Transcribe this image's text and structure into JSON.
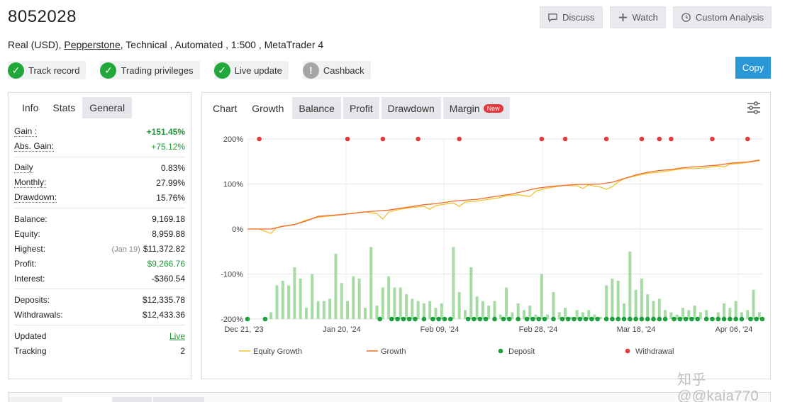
{
  "header": {
    "title": "8052028",
    "account_type": "Real (USD),",
    "broker": "Pepperstone",
    "details": ", Technical , Automated , 1:500 , MetaTrader 4"
  },
  "top_buttons": {
    "discuss": "Discuss",
    "watch": "Watch",
    "custom_analysis": "Custom Analysis"
  },
  "badges": [
    {
      "label": "Track record",
      "icon": "check-icon",
      "status": "ok"
    },
    {
      "label": "Trading privileges",
      "icon": "check-icon",
      "status": "ok"
    },
    {
      "label": "Live update",
      "icon": "check-icon",
      "status": "ok"
    },
    {
      "label": "Cashback",
      "icon": "exclamation-icon",
      "status": "gray"
    }
  ],
  "copy_button": "Copy",
  "left_tabs": [
    "Info",
    "Stats",
    "General"
  ],
  "stats": {
    "gain": {
      "label": "Gain :",
      "value": "+151.45%"
    },
    "abs_gain": {
      "label": "Abs. Gain:",
      "value": "+75.12%"
    },
    "daily": {
      "label": "Daily",
      "value": "0.83%"
    },
    "monthly": {
      "label": "Monthly:",
      "value": "27.99%"
    },
    "drawdown": {
      "label": "Drawdown:",
      "value": "15.76%"
    },
    "balance": {
      "label": "Balance:",
      "value": "9,169.18"
    },
    "equity": {
      "label": "Equity:",
      "value": "8,959.88"
    },
    "highest": {
      "label": "Highest:",
      "note": "(Jan 19)",
      "value": "$11,372.82"
    },
    "profit": {
      "label": "Profit:",
      "value": "$9,266.76"
    },
    "interest": {
      "label": "Interest:",
      "value": "-$360.54"
    },
    "deposits": {
      "label": "Deposits:",
      "value": "$12,335.78"
    },
    "withdrawals": {
      "label": "Withdrawals:",
      "value": "$12,433.36"
    },
    "updated": {
      "label": "Updated",
      "value": "Live"
    },
    "tracking": {
      "label": "Tracking",
      "value": "2"
    }
  },
  "chart_tabs": [
    "Chart",
    "Growth",
    "Balance",
    "Profit",
    "Drawdown",
    "Margin"
  ],
  "new_badge": "New",
  "watermark": "知乎 @@kaia770",
  "chart_data": {
    "type": "line",
    "y_ticks": [
      "200%",
      "100%",
      "0%",
      "-100%",
      "-200%"
    ],
    "ylim": [
      -200,
      200
    ],
    "x_ticks": [
      "Dec 21, '23",
      "Jan 20, '24",
      "Feb 09, '24",
      "Feb 28, '24",
      "Mar 18, '24",
      "Apr 06, '24"
    ],
    "x_range": [
      0,
      112
    ],
    "x_tick_positions": [
      -4,
      16,
      36,
      56,
      76,
      96
    ],
    "grid": true,
    "legend_placement": "bottom",
    "series": [
      {
        "name": "Equity Growth",
        "kind": "line",
        "color": "#f2c230",
        "points": [
          [
            0,
            0
          ],
          [
            4,
            0
          ],
          [
            8,
            -10
          ],
          [
            10,
            4
          ],
          [
            16,
            10
          ],
          [
            20,
            20
          ],
          [
            24,
            26
          ],
          [
            32,
            32
          ],
          [
            40,
            38
          ],
          [
            44,
            34
          ],
          [
            46,
            22
          ],
          [
            48,
            38
          ],
          [
            52,
            44
          ],
          [
            56,
            48
          ],
          [
            60,
            50
          ],
          [
            62,
            44
          ],
          [
            64,
            52
          ],
          [
            70,
            58
          ],
          [
            72,
            50
          ],
          [
            74,
            60
          ],
          [
            78,
            62
          ],
          [
            82,
            66
          ],
          [
            86,
            70
          ],
          [
            88,
            74
          ],
          [
            92,
            76
          ],
          [
            96,
            72
          ],
          [
            98,
            84
          ],
          [
            100,
            88
          ],
          [
            104,
            93
          ],
          [
            108,
            97
          ],
          [
            110,
            96
          ],
          [
            112,
            96
          ],
          [
            114,
            90
          ],
          [
            116,
            98
          ],
          [
            118,
            95
          ],
          [
            120,
            93
          ],
          [
            122,
            88
          ],
          [
            124,
            94
          ],
          [
            126,
            104
          ],
          [
            128,
            112
          ],
          [
            132,
            118
          ],
          [
            136,
            124
          ],
          [
            140,
            126
          ],
          [
            144,
            130
          ],
          [
            148,
            134
          ],
          [
            152,
            134
          ],
          [
            156,
            136
          ],
          [
            160,
            140
          ],
          [
            162,
            138
          ],
          [
            164,
            144
          ],
          [
            168,
            146
          ],
          [
            170,
            148
          ],
          [
            172,
            150
          ],
          [
            174,
            152
          ]
        ]
      },
      {
        "name": "Growth",
        "kind": "line",
        "color": "#f26a2a",
        "points": [
          [
            0,
            0
          ],
          [
            8,
            0
          ],
          [
            12,
            6
          ],
          [
            16,
            10
          ],
          [
            20,
            18
          ],
          [
            24,
            28
          ],
          [
            32,
            32
          ],
          [
            40,
            38
          ],
          [
            44,
            40
          ],
          [
            48,
            42
          ],
          [
            52,
            46
          ],
          [
            56,
            50
          ],
          [
            60,
            54
          ],
          [
            64,
            56
          ],
          [
            70,
            62
          ],
          [
            74,
            64
          ],
          [
            78,
            66
          ],
          [
            82,
            70
          ],
          [
            86,
            74
          ],
          [
            90,
            78
          ],
          [
            94,
            84
          ],
          [
            98,
            90
          ],
          [
            100,
            92
          ],
          [
            104,
            95
          ],
          [
            108,
            97
          ],
          [
            112,
            99
          ],
          [
            116,
            99
          ],
          [
            120,
            100
          ],
          [
            124,
            104
          ],
          [
            128,
            112
          ],
          [
            132,
            120
          ],
          [
            136,
            126
          ],
          [
            140,
            130
          ],
          [
            144,
            132
          ],
          [
            148,
            136
          ],
          [
            152,
            138
          ],
          [
            156,
            140
          ],
          [
            160,
            142
          ],
          [
            164,
            146
          ],
          [
            168,
            148
          ],
          [
            170,
            149
          ],
          [
            172,
            151
          ],
          [
            174,
            153
          ]
        ]
      },
      {
        "name": "Deposit",
        "kind": "dots",
        "color": "#1a9e3a",
        "x": [
          0,
          6,
          45,
          49,
          51,
          53,
          55,
          57,
          60,
          63,
          65,
          67,
          69,
          75,
          77,
          79,
          81,
          84,
          87,
          89,
          92,
          95,
          97,
          99,
          101,
          104,
          107,
          109,
          111,
          113,
          115,
          117,
          119,
          122,
          124,
          126,
          128,
          130,
          132,
          134,
          136,
          138,
          140,
          142,
          145,
          147,
          149,
          151,
          153,
          156,
          158,
          160,
          162,
          164,
          166,
          168,
          171,
          173,
          175
        ]
      },
      {
        "name": "Withdrawal",
        "kind": "dots",
        "color": "#e53b3b",
        "x": [
          4,
          34,
          46,
          58,
          72,
          100,
          108,
          122,
          134,
          140,
          144,
          158,
          170
        ]
      },
      {
        "name": "Bars",
        "kind": "bars",
        "color": "#a6dba6",
        "x": [
          8,
          10,
          12,
          14,
          16,
          18,
          20,
          22,
          24,
          26,
          28,
          30,
          32,
          34,
          36,
          38,
          40,
          42,
          44,
          46,
          48,
          50,
          52,
          54,
          56,
          58,
          60,
          62,
          64,
          66,
          70,
          72,
          74,
          76,
          78,
          80,
          82,
          84,
          86,
          88,
          90,
          92,
          94,
          96,
          98,
          100,
          102,
          104,
          106,
          108,
          110,
          112,
          114,
          116,
          118,
          120,
          122,
          124,
          126,
          128,
          130,
          132,
          134,
          136,
          138,
          140,
          142,
          144,
          146,
          148,
          150,
          152,
          154,
          156,
          158,
          160,
          162,
          164,
          166,
          168,
          170,
          172,
          174
        ],
        "values": [
          -185,
          -125,
          -115,
          -125,
          -85,
          -110,
          -175,
          -100,
          -160,
          -160,
          -155,
          -55,
          -120,
          -160,
          -105,
          -110,
          -175,
          -40,
          -170,
          -130,
          -105,
          -130,
          -130,
          -145,
          -155,
          -160,
          -165,
          -160,
          -175,
          -165,
          -40,
          -140,
          -180,
          -85,
          -150,
          -160,
          -170,
          -160,
          -190,
          -130,
          -185,
          -165,
          -180,
          -170,
          -190,
          -100,
          -190,
          -140,
          -185,
          -175,
          -195,
          -180,
          -185,
          -180,
          -190,
          -195,
          -125,
          -110,
          -115,
          -165,
          -50,
          -135,
          -110,
          -145,
          -160,
          -155,
          -180,
          -185,
          -190,
          -175,
          -180,
          -170,
          -185,
          -180,
          -195,
          -185,
          -165,
          -175,
          -160,
          -185,
          -180,
          -135,
          -185
        ]
      }
    ]
  },
  "legend": [
    "Equity Growth",
    "Growth",
    "Deposit",
    "Withdrawal"
  ]
}
